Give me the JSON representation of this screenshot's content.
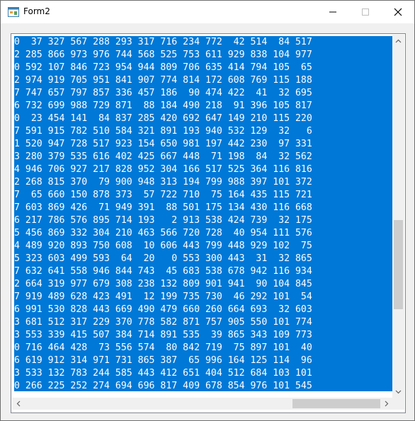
{
  "window": {
    "title": "Form2",
    "icons": {
      "app": "form-app-icon",
      "minimize": "minimize-icon",
      "maximize": "maximize-icon",
      "close": "close-icon"
    }
  },
  "listbox": {
    "rows": [
      "0  37 327 567 288 293 317 716 234 772  42 514  84 517",
      "2 285 866 973 976 744 568 525 753 611 929 838 104 977",
      "0 592 107 846 723 954 944 809 706 635 414 794 105  65",
      "2 974 919 705 951 841 907 774 814 172 608 769 115 188",
      "7 747 657 797 857 336 457 186  90 474 422  41  32 695",
      "6 732 699 988 729 871  88 184 490 218  91 396 105 817",
      "0  23 454 141  84 837 285 420 692 647 149 210 115 220",
      "7 591 915 782 510 584 321 891 193 940 532 129  32   6",
      "1 520 947 728 517 923 154 650 981 197 442 230  97 331",
      "3 280 379 535 616 402 425 667 448  71 198  84  32 562",
      "4 946 706 927 217 828 952 304 166 517 525 364 116 816",
      "2 268 815 370  79 900 948 313 194 799 988 397 101 372",
      "7  65 660 150 878 373  57 722 710  75 164 435 115 721",
      "7 603 869 426  71 949 391  88 501 175 134 430 116 668",
      "6 217 786 576 895 714 193   2 913 538 424 739  32 175",
      "5 456 869 332 304 210 463 566 720 728  40 954 111 576",
      "4 489 920 893 750 608  10 606 443 799 448 929 102  75",
      "5 323 603 499 593  64  20   0 553 300 443  31  32 865",
      "7 632 641 558 946 844 743  45 683 538 678 942 116 934",
      "2 664 319 977 679 308 238 132 809 901 941  90 104 845",
      "7 919 489 628 423 491  12 199 735 730  46 292 101  54",
      "6 991 530 828 443 669 490 479 660 260 664 693  32 603",
      "3 681 512 317 229 370 778 582 871 757 905 550 101 774",
      "3 553 339 415 507 384 714 891 535  39 865 343 109 773",
      "0 716 464 428  73 556 574  80 842 719  75 897 101  40",
      "6 619 912 314 971 731 865 387  65 996 164 125 114  96",
      "3 533 132 783 244 585 443 412 651 404 512 684 103 101",
      "0 266 225 252 274 694 696 817 409 678 854 976 101 545"
    ],
    "selected_color": "#0078d7",
    "scrollbar_icons": {
      "up": "arrow-up-icon",
      "down": "arrow-down-icon",
      "left": "arrow-left-icon",
      "right": "arrow-right-icon"
    }
  }
}
